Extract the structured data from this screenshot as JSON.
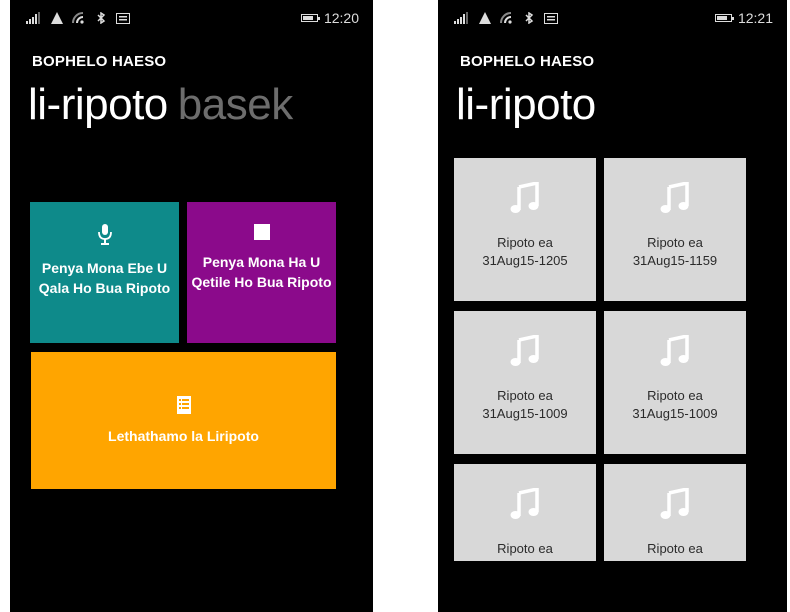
{
  "left_screen": {
    "status_time": "12:20",
    "app_title": "BOPHELO HAESO",
    "pivot_active": "li-ripoto",
    "pivot_next": "basek",
    "tiles": {
      "start_label": "Penya Mona Ebe U Qala Ho Bua Ripoto",
      "stop_label": "Penya Mona Ha U Qetile Ho Bua Ripoto",
      "list_label": "Lethathamo la Liripoto"
    },
    "colors": {
      "start": "#0e8a8a",
      "stop": "#8b0a8b",
      "list": "#ffa500"
    },
    "icons": {
      "start": "microphone-icon",
      "stop": "stop-icon",
      "list": "list-icon"
    }
  },
  "right_screen": {
    "status_time": "12:21",
    "app_title": "BOPHELO HAESO",
    "pivot_active": "li-ripoto",
    "reports": [
      {
        "line1": "Ripoto ea",
        "line2": "31Aug15-1205"
      },
      {
        "line1": "Ripoto ea",
        "line2": "31Aug15-1159"
      },
      {
        "line1": "Ripoto ea",
        "line2": "31Aug15-1009"
      },
      {
        "line1": "Ripoto ea",
        "line2": "31Aug15-1009"
      },
      {
        "line1": "Ripoto ea",
        "line2": ""
      },
      {
        "line1": "Ripoto ea",
        "line2": ""
      }
    ],
    "icons": {
      "report": "music-note-icon"
    }
  }
}
